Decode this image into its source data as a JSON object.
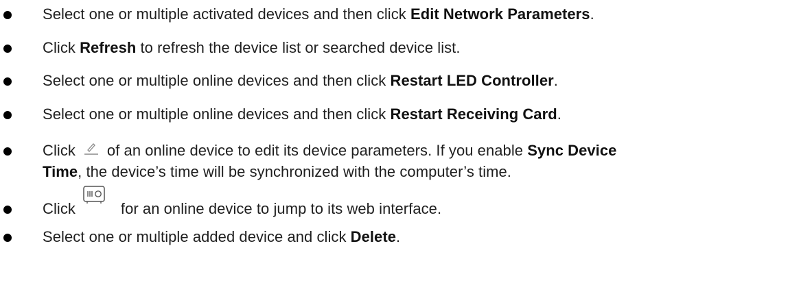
{
  "items": [
    {
      "before": "Select one or multiple activated devices and then click ",
      "bold": "Edit Network Parameters",
      "after": "."
    },
    {
      "before": "Click ",
      "bold": "Refresh",
      "after": " to refresh the device list or searched device list."
    },
    {
      "before": "Select one or multiple online devices and then click ",
      "bold": "Restart LED Controller",
      "after": "."
    },
    {
      "before": "Select one or multiple online devices and then click ",
      "bold": "Restart Receiving Card",
      "after": "."
    },
    {
      "click": "Click",
      "icon": "pencil-edit-icon",
      "line1_before": "of an online device to edit its device parameters. If you enable ",
      "line1_bold": "Sync Device",
      "line2_bold": "Time",
      "line2_after": ", the device’s time will be synchronized with the computer’s time."
    },
    {
      "click": "Click",
      "icon": "device-web-icon",
      "after": "for an online device to jump to its web interface."
    },
    {
      "before": "Select one or multiple added device and click ",
      "bold": "Delete",
      "after": "."
    }
  ]
}
